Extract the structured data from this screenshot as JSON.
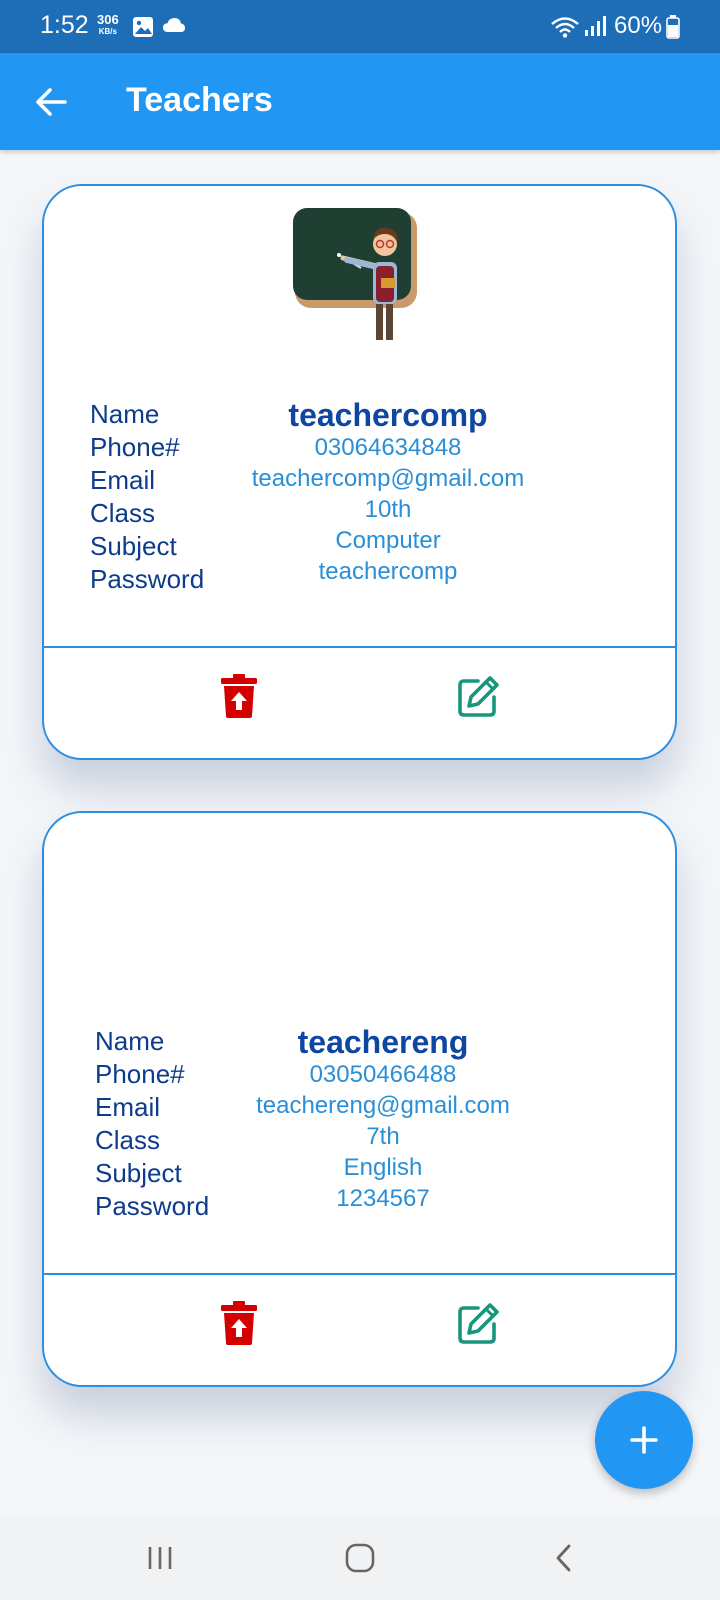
{
  "status_bar": {
    "time": "1:52",
    "speed_value": "306",
    "speed_unit": "KB/s",
    "battery": "60%"
  },
  "app_bar": {
    "title": "Teachers"
  },
  "field_labels": {
    "name": "Name",
    "phone": "Phone#",
    "email": "Email",
    "class": "Class",
    "subject": "Subject",
    "password": "Password"
  },
  "teachers": [
    {
      "name": "teachercomp",
      "phone": "03064634848",
      "email": "teachercomp@gmail.com",
      "class": "10th",
      "subject": "Computer",
      "password": "teachercomp",
      "photo_icon": "teacher-at-blackboard-illustration"
    },
    {
      "name": "teachereng",
      "phone": "03050466488",
      "email": "teachereng@gmail.com",
      "class": "7th",
      "subject": "English",
      "password": "1234567",
      "photo_icon": "none"
    }
  ],
  "icons": {
    "back": "arrow-left-icon",
    "delete": "trash-icon",
    "edit": "edit-icon",
    "add": "plus-icon"
  },
  "colors": {
    "app_bar": "#2196f3",
    "status_bar": "#1e6db7",
    "label_text": "#0d3c8c",
    "value_text": "#2a8fd6",
    "delete_icon": "#d40000",
    "edit_icon": "#17967c"
  }
}
